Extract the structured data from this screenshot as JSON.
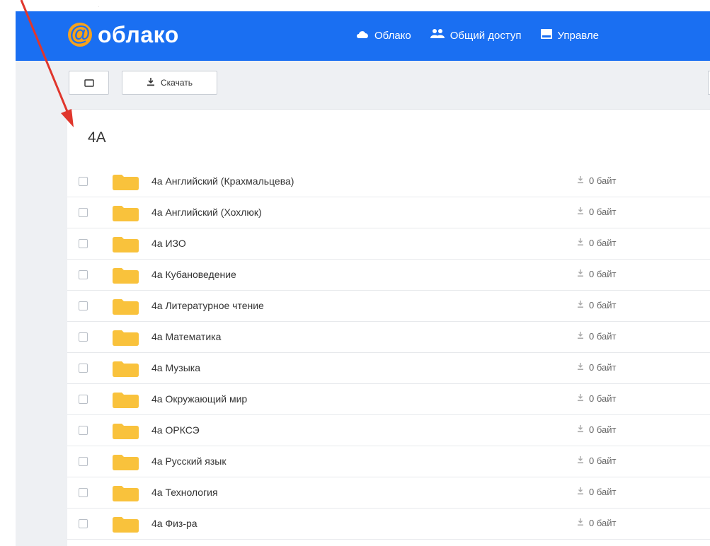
{
  "header": {
    "logo_text": "облако",
    "logo_symbol": "@",
    "nav": [
      {
        "label": "Облако",
        "icon": "cloud-icon"
      },
      {
        "label": "Общий доступ",
        "icon": "users-icon"
      },
      {
        "label": "Управле",
        "icon": "panel-icon"
      }
    ]
  },
  "toolbar": {
    "download_label": "Скачать",
    "download_icon": "download-icon"
  },
  "folder": {
    "title": "4A"
  },
  "files": [
    {
      "name": "4а Английский (Крахмальцева)",
      "size": "0 байт"
    },
    {
      "name": "4а Английский (Хохлюк)",
      "size": "0 байт"
    },
    {
      "name": "4а ИЗО",
      "size": "0 байт"
    },
    {
      "name": "4а Кубановедение",
      "size": "0 байт"
    },
    {
      "name": "4а Литературное чтение",
      "size": "0 байт"
    },
    {
      "name": "4а Математика",
      "size": "0 байт"
    },
    {
      "name": "4а Музыка",
      "size": "0 байт"
    },
    {
      "name": "4а Окружающий мир",
      "size": "0 байт"
    },
    {
      "name": "4а ОРКСЭ",
      "size": "0 байт"
    },
    {
      "name": "4а Русский язык",
      "size": "0 байт"
    },
    {
      "name": "4а Технология",
      "size": "0 байт"
    },
    {
      "name": "4а Физ-ра",
      "size": "0 байт"
    }
  ],
  "colors": {
    "header_bg": "#1a6ff2",
    "logo_accent": "#f7a21b",
    "folder": "#f9c23c",
    "annotation_arrow": "#e0362c"
  }
}
